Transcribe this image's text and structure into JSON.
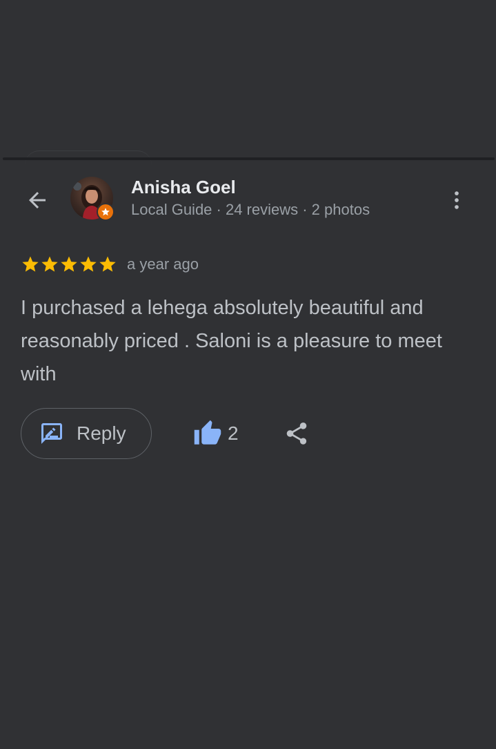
{
  "reviewer": {
    "name": "Anisha Goel",
    "meta": "Local Guide · 24 reviews · 2 photos",
    "avatar_icon": "profile-photo",
    "badge_icon": "local-guide-star-icon"
  },
  "review": {
    "rating": 5,
    "rating_max": 5,
    "time": "a year ago",
    "text": "I purchased a lehega absolutely beautiful and reasonably priced . Saloni is a pleasure to meet with"
  },
  "actions": {
    "reply_label": "Reply",
    "like_count": "2"
  },
  "icons": {
    "back": "arrow-left-icon",
    "more": "more-vert-icon",
    "reply": "rate-review-icon",
    "like": "thumb-up-icon",
    "share": "share-icon"
  },
  "colors": {
    "background": "#303134",
    "star": "#fbbc04",
    "like_accent": "#8ab4f8",
    "guide_badge": "#e8710a",
    "primary_text": "#e8eaed",
    "secondary_text": "#9aa0a6"
  }
}
